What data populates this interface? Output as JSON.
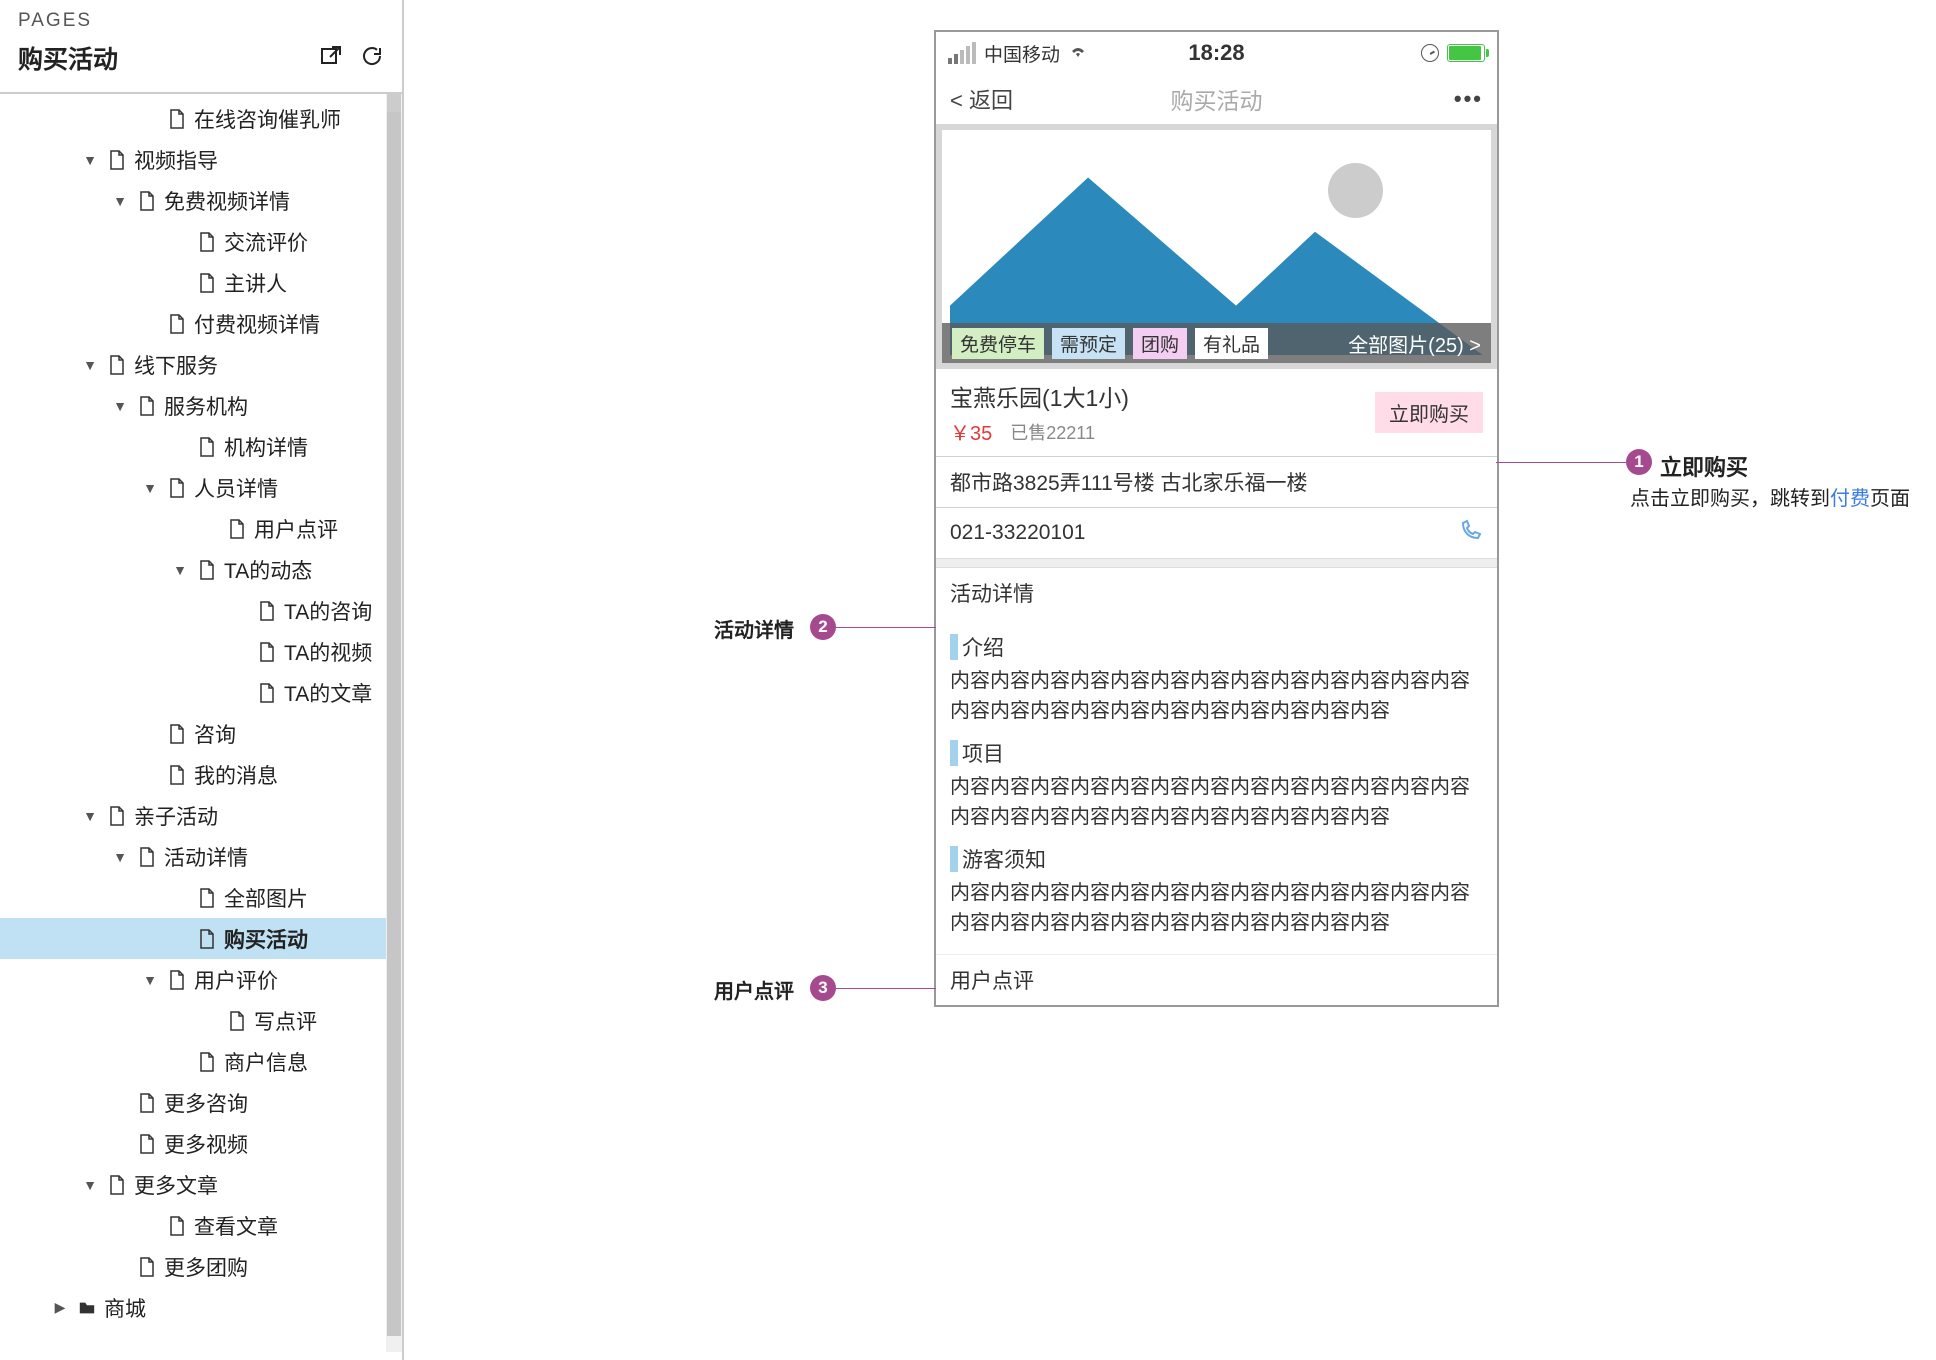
{
  "pages_panel": {
    "label": "PAGES",
    "title": "购买活动"
  },
  "tree": [
    {
      "indent": 4,
      "caret": "",
      "icon": "page",
      "label": "在线咨询催乳师"
    },
    {
      "indent": 2,
      "caret": "▼",
      "icon": "page",
      "label": "视频指导"
    },
    {
      "indent": 3,
      "caret": "▼",
      "icon": "page",
      "label": "免费视频详情"
    },
    {
      "indent": 5,
      "caret": "",
      "icon": "page",
      "label": "交流评价"
    },
    {
      "indent": 5,
      "caret": "",
      "icon": "page",
      "label": "主讲人"
    },
    {
      "indent": 4,
      "caret": "",
      "icon": "page",
      "label": "付费视频详情"
    },
    {
      "indent": 2,
      "caret": "▼",
      "icon": "page",
      "label": "线下服务"
    },
    {
      "indent": 3,
      "caret": "▼",
      "icon": "page",
      "label": "服务机构"
    },
    {
      "indent": 5,
      "caret": "",
      "icon": "page",
      "label": "机构详情"
    },
    {
      "indent": 4,
      "caret": "▼",
      "icon": "page",
      "label": "人员详情"
    },
    {
      "indent": 6,
      "caret": "",
      "icon": "page",
      "label": "用户点评"
    },
    {
      "indent": 5,
      "caret": "▼",
      "icon": "page",
      "label": "TA的动态"
    },
    {
      "indent": 7,
      "caret": "",
      "icon": "page",
      "label": "TA的咨询"
    },
    {
      "indent": 7,
      "caret": "",
      "icon": "page",
      "label": "TA的视频"
    },
    {
      "indent": 7,
      "caret": "",
      "icon": "page",
      "label": "TA的文章"
    },
    {
      "indent": 4,
      "caret": "",
      "icon": "page",
      "label": "咨询"
    },
    {
      "indent": 4,
      "caret": "",
      "icon": "page",
      "label": "我的消息"
    },
    {
      "indent": 2,
      "caret": "▼",
      "icon": "page",
      "label": "亲子活动"
    },
    {
      "indent": 3,
      "caret": "▼",
      "icon": "page",
      "label": "活动详情"
    },
    {
      "indent": 5,
      "caret": "",
      "icon": "page",
      "label": "全部图片"
    },
    {
      "indent": 5,
      "caret": "",
      "icon": "page",
      "label": "购买活动",
      "selected": true
    },
    {
      "indent": 4,
      "caret": "▼",
      "icon": "page",
      "label": "用户评价"
    },
    {
      "indent": 6,
      "caret": "",
      "icon": "page",
      "label": "写点评"
    },
    {
      "indent": 5,
      "caret": "",
      "icon": "page",
      "label": "商户信息"
    },
    {
      "indent": 3,
      "caret": "",
      "icon": "page",
      "label": "更多咨询"
    },
    {
      "indent": 3,
      "caret": "",
      "icon": "page",
      "label": "更多视频"
    },
    {
      "indent": 2,
      "caret": "▼",
      "icon": "page",
      "label": "更多文章"
    },
    {
      "indent": 4,
      "caret": "",
      "icon": "page",
      "label": "查看文章"
    },
    {
      "indent": 3,
      "caret": "",
      "icon": "page",
      "label": "更多团购"
    },
    {
      "indent": 1,
      "caret": "▶",
      "icon": "folder",
      "label": "商城"
    }
  ],
  "phone": {
    "carrier": "中国移动",
    "time": "18:28",
    "back": "< 返回",
    "nav_title": "购买活动",
    "more": "•••",
    "tags": [
      "免费停车",
      "需预定",
      "团购",
      "有礼品"
    ],
    "all_pics": "全部图片(25) >",
    "venue": "宝燕乐园(1大1小)",
    "price": "￥35",
    "sold": "已售22211",
    "buy": "立即购买",
    "address": "都市路3825弄111号楼 古北家乐福一楼",
    "tel": "021-33220101",
    "section_activity": "活动详情",
    "sub_intro": "介绍",
    "sub_items": "项目",
    "sub_notice": "游客须知",
    "content": "内容内容内容内容内容内容内容内容内容内容内容内容内容内容内容内容内容内容内容内容内容内容内容内容",
    "section_reviews": "用户点评"
  },
  "annotations": {
    "a1_title": "立即购买",
    "a1_text_pre": "点击立即购买，跳转到",
    "a1_link": "付费",
    "a1_text_post": "页面",
    "a2_label": "活动详情",
    "a3_label": "用户点评"
  }
}
